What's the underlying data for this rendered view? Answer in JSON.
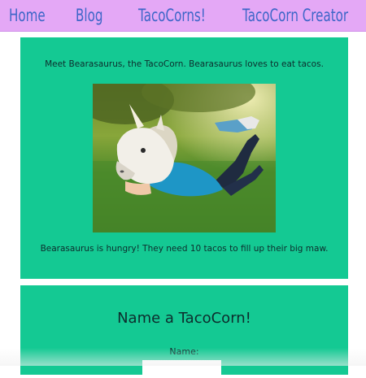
{
  "nav": {
    "home": "Home",
    "blog": "Blog",
    "tacocorns": "TacoCorns!",
    "creator": "TacoCorn Creator"
  },
  "profile": {
    "intro": "Meet Bearasaurus, the TacoCorn. Bearasaurus loves to eat tacos.",
    "photo_alt": "Bearasaurus",
    "hungry": "Bearasaurus is hungry! They need 10 tacos to fill up their big maw."
  },
  "form": {
    "title": "Name a TacoCorn!",
    "name_label": "Name:",
    "name_value": ""
  },
  "colors": {
    "nav_bg": "#e4a8f6",
    "nav_text": "#3e66c8",
    "panel_bg": "#14c993"
  }
}
